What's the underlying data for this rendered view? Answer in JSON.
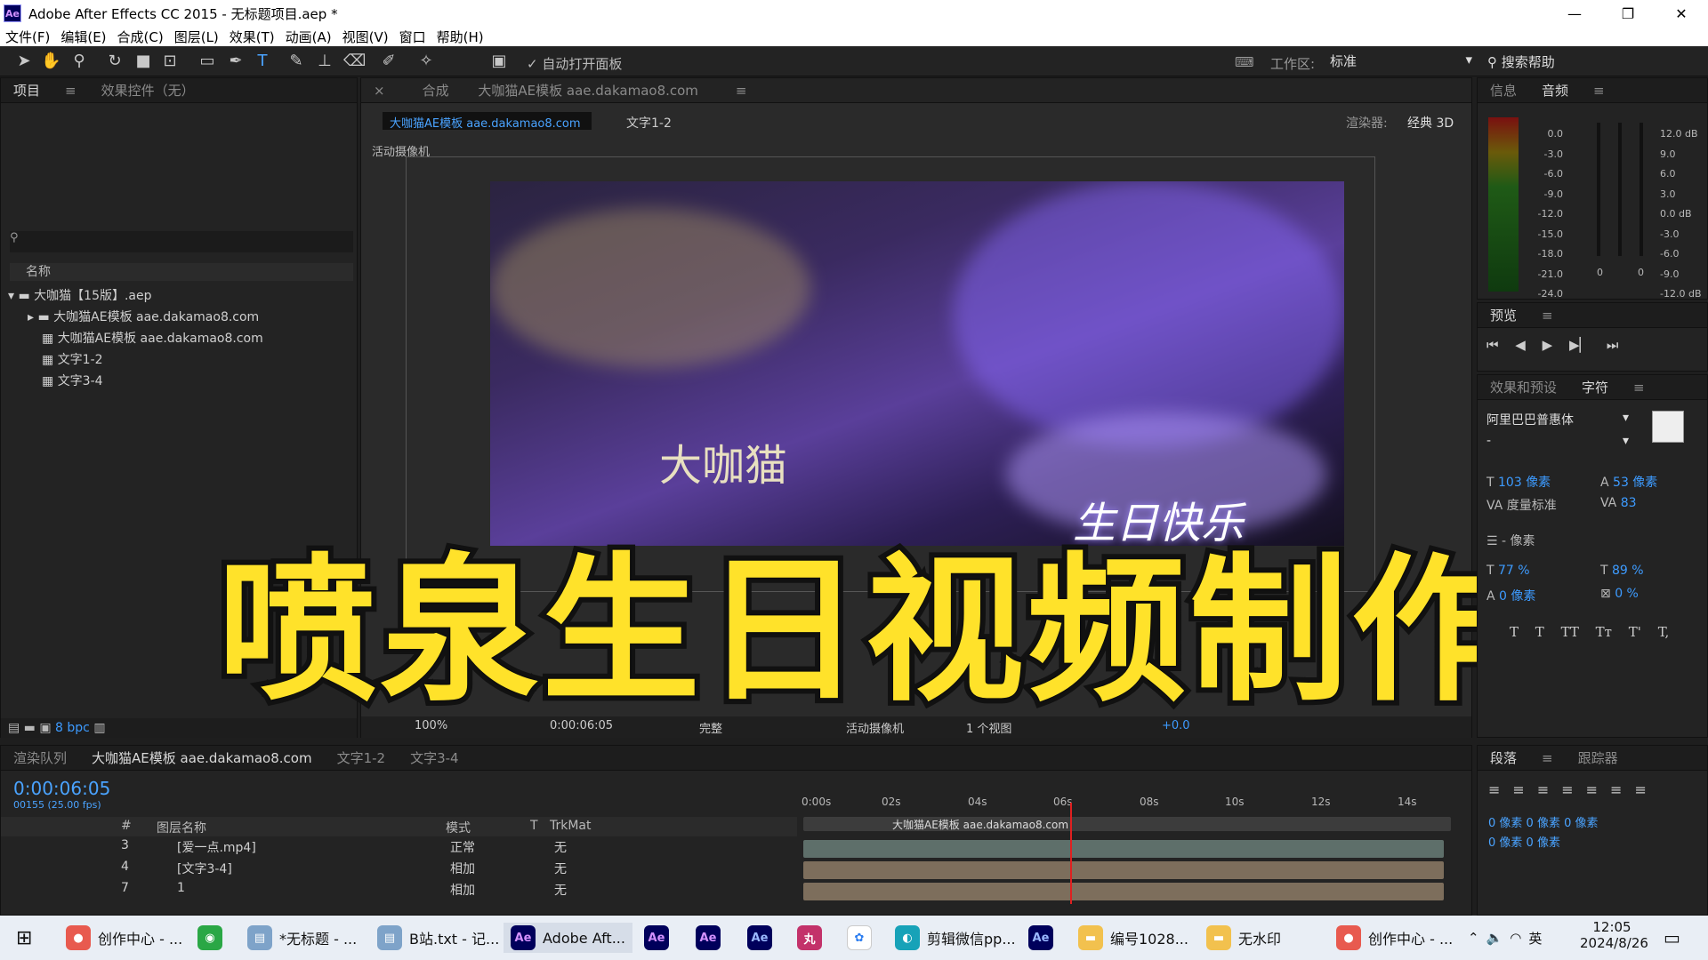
{
  "window": {
    "title": "Adobe After Effects CC 2015 - 无标题项目.aep *",
    "min": "—",
    "max": "❐",
    "close": "✕"
  },
  "menu": [
    "文件(F)",
    "编辑(E)",
    "合成(C)",
    "图层(L)",
    "效果(T)",
    "动画(A)",
    "视图(V)",
    "窗口",
    "帮助(H)"
  ],
  "toolbar": {
    "auto_open": "自动打开面板",
    "workspace_label": "工作区:",
    "workspace": "标准",
    "search_help": "搜索帮助"
  },
  "project": {
    "tab1": "项目",
    "tab2": "效果控件（无）",
    "name_col": "名称",
    "items": [
      "大咖猫【15版】.aep",
      "大咖猫AE模板 aae.dakamao8.com",
      "大咖猫AE模板 aae.dakamao8.com",
      "文字1-2",
      "文字3-4"
    ],
    "bpc": "8 bpc"
  },
  "comp": {
    "tab_prefix": "合成",
    "tab_name": "大咖猫AE模板 aae.dakamao8.com",
    "crumb1": "大咖猫AE模板 aae.dakamao8.com",
    "crumb2": "文字1-2",
    "renderer_label": "渲染器:",
    "renderer": "经典 3D",
    "camera": "活动摄像机",
    "text1": "大咖猫",
    "text2": "生日快乐",
    "zoom": "100%",
    "time": "0:00:06:05",
    "quality": "完整",
    "view_camera": "活动摄像机",
    "views": "1 个视图",
    "exposure": "+0.0"
  },
  "overlay": "喷泉生日视频制作",
  "right": {
    "info": "信息",
    "audio": "音频",
    "db_left": [
      "0.0",
      "-3.0",
      "-6.0",
      "-9.0",
      "-12.0",
      "-15.0",
      "-18.0",
      "-21.0",
      "-24.0"
    ],
    "db_right": [
      "12.0 dB",
      "9.0",
      "6.0",
      "3.0",
      "0.0 dB",
      "-3.0",
      "-6.0",
      "-9.0",
      "-12.0 dB"
    ],
    "zero1": "0",
    "zero2": "0",
    "preview": "预览",
    "effects": "效果和预设",
    "character": "字符",
    "font": "阿里巴巴普惠体",
    "font_style": "-",
    "size": "103 像素",
    "leading": "53 像素",
    "kerning": "度量标准",
    "tracking": "83",
    "stroke": "- 像素",
    "vscale": "77 %",
    "hscale": "89 %",
    "baseline": "0 像素",
    "tsume": "0 %",
    "styles": [
      "T",
      "T",
      "TT",
      "Tт",
      "T'",
      "T,"
    ],
    "para": "段落",
    "tracker": "跟踪器",
    "indent": [
      "0 像素",
      "0 像素",
      "0 像素",
      "0 像素",
      "0 像素"
    ]
  },
  "timeline": {
    "tabs": [
      "渲染队列",
      "大咖猫AE模板 aae.dakamao8.com",
      "文字1-2",
      "文字3-4"
    ],
    "time": "0:00:06:05",
    "frames": "00155 (25.00 fps)",
    "cols": [
      "#",
      "图层名称",
      "模式",
      "T",
      "TrkMat"
    ],
    "ticks": [
      "0:00s",
      "02s",
      "04s",
      "06s",
      "08s",
      "10s",
      "12s",
      "14s"
    ],
    "bar_label": "大咖猫AE模板 aae.dakamao8.com",
    "layers": [
      {
        "num": "3",
        "name": "[爱一点.mp4]",
        "mode": "正常",
        "trk": "无"
      },
      {
        "num": "4",
        "name": "[文字3-4]",
        "mode": "相加",
        "trk": "无"
      },
      {
        "num": "7",
        "name": "1",
        "mode": "相加",
        "trk": "无"
      }
    ]
  },
  "taskbar": {
    "items": [
      "创作中心 - ...",
      "*无标题 - ...",
      "B站.txt - 记...",
      "Adobe Aft...",
      "剪辑微信pp...",
      "编号1028...",
      "无水印",
      "创作中心 - ..."
    ],
    "time": "12:05",
    "date": "2024/8/26",
    "lang": "英"
  }
}
